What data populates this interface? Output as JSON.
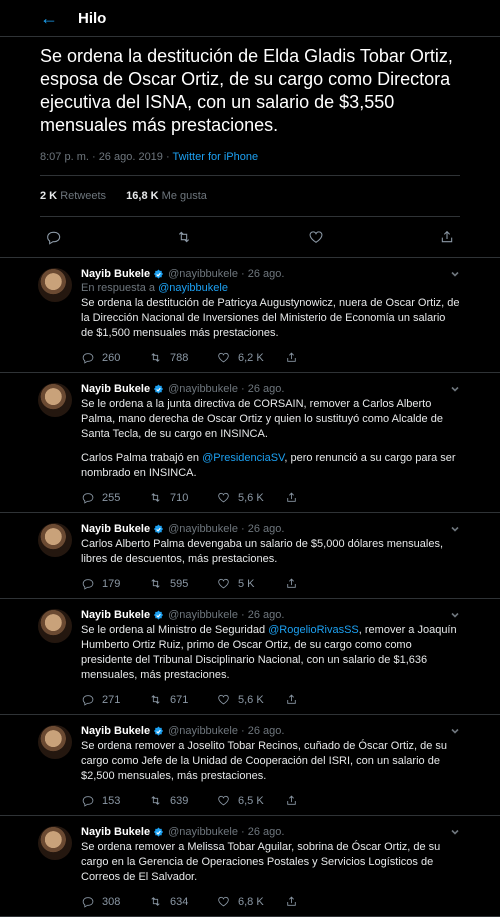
{
  "header": {
    "back_icon": "arrow-left-icon",
    "title": "Hilo"
  },
  "main": {
    "text": "Se ordena la destitución de Elda Gladis Tobar Ortiz, esposa de Oscar Ortiz, de su cargo como Directora ejecutiva del ISNA, con un salario de $3,550 mensuales más prestaciones.",
    "time": "8:07 p. m. · 26 ago. 2019 · ",
    "source": "Twitter for iPhone",
    "retweets_count": "2 K",
    "retweets_label": "Retweets",
    "likes_count": "16,8 K",
    "likes_label": "Me gusta"
  },
  "replies": [
    {
      "name": "Nayib Bukele",
      "handle": "@nayibbukele · 26 ago.",
      "replying_prefix": "En respuesta a ",
      "replying_to": "@nayibbukele",
      "paragraphs": [
        "Se ordena la destitución de Patricya Augustynowicz, nuera de Oscar Ortiz, de la Dirección Nacional de Inversiones del Ministerio de Economía un salario de $1,500 mensuales más prestaciones."
      ],
      "replies": "260",
      "retweets": "788",
      "likes": "6,2 K"
    },
    {
      "name": "Nayib Bukele",
      "handle": "@nayibbukele · 26 ago.",
      "paragraphs": [
        "Se le ordena a la junta directiva de CORSAIN, remover a Carlos Alberto Palma, mano derecha de Oscar Ortiz y quien lo sustituyó como Alcalde de Santa Tecla, de su cargo en INSINCA."
      ],
      "p2_before": "Carlos Palma trabajó en ",
      "p2_link": "@PresidenciaSV",
      "p2_after": ", pero renunció a su cargo para ser nombrado en INSINCA.",
      "replies": "255",
      "retweets": "710",
      "likes": "5,6 K"
    },
    {
      "name": "Nayib Bukele",
      "handle": "@nayibbukele · 26 ago.",
      "paragraphs": [
        "Carlos Alberto Palma devengaba un salario de $5,000 dólares mensuales, libres de descuentos, más prestaciones."
      ],
      "replies": "179",
      "retweets": "595",
      "likes": "5 K"
    },
    {
      "name": "Nayib Bukele",
      "handle": "@nayibbukele · 26 ago.",
      "p_before": "Se le ordena al Ministro de Seguridad ",
      "p_link": "@RogelioRivasSS",
      "p_after": ", remover a Joaquín Humberto Ortiz Ruiz, primo de Oscar Ortiz, de su cargo como como presidente del Tribunal Disciplinario Nacional, con un salario de $1,636 mensuales, más prestaciones.",
      "replies": "271",
      "retweets": "671",
      "likes": "5,6 K"
    },
    {
      "name": "Nayib Bukele",
      "handle": "@nayibbukele · 26 ago.",
      "paragraphs": [
        "Se ordena remover a Joselito Tobar Recinos, cuñado de Óscar Ortiz, de su cargo como Jefe de la Unidad de Cooperación del ISRI, con un salario de $2,500 mensuales, más prestaciones."
      ],
      "replies": "153",
      "retweets": "639",
      "likes": "6,5 K"
    },
    {
      "name": "Nayib Bukele",
      "handle": "@nayibbukele · 26 ago.",
      "paragraphs": [
        "Se ordena remover a Melissa Tobar Aguilar, sobrina de Óscar Ortiz, de su cargo en la Gerencia de Operaciones Postales y Servicios Logísticos de Correos de El Salvador."
      ],
      "replies": "308",
      "retweets": "634",
      "likes": "6,8 K"
    }
  ],
  "colors": {
    "accent": "#1da1f2",
    "background": "#000000",
    "muted": "#6e767d"
  }
}
